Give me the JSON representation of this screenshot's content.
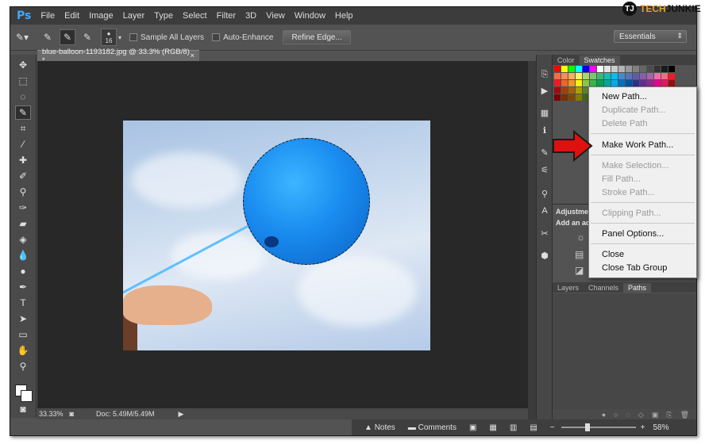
{
  "app": {
    "logo": "Ps"
  },
  "menu": [
    "File",
    "Edit",
    "Image",
    "Layer",
    "Type",
    "Select",
    "Filter",
    "3D",
    "View",
    "Window",
    "Help"
  ],
  "options": {
    "brush_size": "16",
    "sample_all_layers": "Sample All Layers",
    "auto_enhance": "Auto-Enhance",
    "refine_edge": "Refine Edge...",
    "workspace": "Essentials"
  },
  "document": {
    "tab_title": "blue-balloon-1193182.jpg @ 33.3% (RGB/8) *",
    "zoom": "33.33%",
    "doc_info": "Doc: 5.49M/5.49M"
  },
  "panels": {
    "color_tab": "Color",
    "swatches_tab": "Swatches",
    "adjustments_title": "Adjustmen",
    "adjustments_sub": "Add an ad",
    "layers_tab": "Layers",
    "channels_tab": "Channels",
    "paths_tab": "Paths"
  },
  "bottombar": {
    "notes": "Notes",
    "comments": "Comments",
    "zoom": "58%"
  },
  "context_menu": {
    "items": [
      {
        "label": "New Path...",
        "enabled": true
      },
      {
        "label": "Duplicate Path...",
        "enabled": false
      },
      {
        "label": "Delete Path",
        "enabled": false
      },
      {
        "label": "Make Work Path...",
        "enabled": true
      },
      {
        "label": "Make Selection...",
        "enabled": false
      },
      {
        "label": "Fill Path...",
        "enabled": false
      },
      {
        "label": "Stroke Path...",
        "enabled": false
      },
      {
        "label": "Clipping Path...",
        "enabled": false
      },
      {
        "label": "Panel Options...",
        "enabled": true
      },
      {
        "label": "Close",
        "enabled": true
      },
      {
        "label": "Close Tab Group",
        "enabled": true
      }
    ]
  },
  "watermark": {
    "tech": "TECH",
    "junkie": "JUNKIE"
  },
  "colors": {
    "accent": "#3fa8ff",
    "arrow": "#e01010",
    "bg": "#535353"
  }
}
